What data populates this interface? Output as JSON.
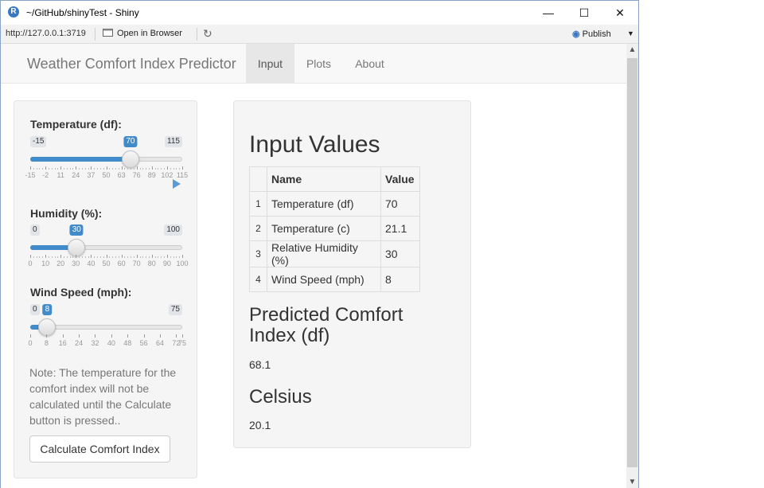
{
  "window": {
    "title": "~/GitHub/shinyTest - Shiny",
    "logo_letter": "R",
    "min_glyph": "—",
    "max_glyph": "☐",
    "close_glyph": "✕"
  },
  "toolbar": {
    "url": "http://127.0.0.1:3719",
    "open_in_browser": "Open in Browser",
    "refresh_glyph": "↻",
    "publish": "Publish",
    "publish_dropdown_glyph": "▼"
  },
  "navbar": {
    "brand": "Weather Comfort Index Predictor",
    "tabs": [
      {
        "label": "Input",
        "active": true
      },
      {
        "label": "Plots",
        "active": false
      },
      {
        "label": "About",
        "active": false
      }
    ]
  },
  "sidebar": {
    "sliders": [
      {
        "label": "Temperature (df):",
        "min": -15,
        "max": 115,
        "value": 70,
        "min_text": "-15",
        "max_text": "115",
        "value_text": "70",
        "tick_labels": [
          "-15",
          "-2",
          "11",
          "24",
          "37",
          "50",
          "63",
          "76",
          "89",
          "102",
          "115"
        ],
        "has_play_button": true
      },
      {
        "label": "Humidity (%):",
        "min": 0,
        "max": 100,
        "value": 30,
        "min_text": "0",
        "max_text": "100",
        "value_text": "30",
        "tick_labels": [
          "0",
          "10",
          "20",
          "30",
          "40",
          "50",
          "60",
          "70",
          "80",
          "90",
          "100"
        ],
        "has_play_button": false
      },
      {
        "label": "Wind Speed (mph):",
        "min": 0,
        "max": 75,
        "value": 8,
        "min_text": "0",
        "max_text": "75",
        "value_text": "8",
        "tick_labels": [
          "0",
          "8",
          "16",
          "24",
          "32",
          "40",
          "48",
          "56",
          "64",
          "72",
          "75"
        ],
        "tick_values": [
          0,
          8,
          16,
          24,
          32,
          40,
          48,
          56,
          64,
          72,
          75
        ],
        "has_play_button": false
      }
    ],
    "note": "Note: The temperature for the comfort index will not be calculated until the Calculate button is pressed..",
    "calculate_button": "Calculate Comfort Index"
  },
  "main": {
    "input_heading": "Input Values",
    "table": {
      "headers": [
        "",
        "Name",
        "Value"
      ],
      "rows": [
        {
          "n": "1",
          "name": "Temperature (df)",
          "value": "70"
        },
        {
          "n": "2",
          "name": "Temperature (c)",
          "value": "21.1"
        },
        {
          "n": "3",
          "name": "Relative Humidity (%)",
          "value": "30"
        },
        {
          "n": "4",
          "name": "Wind Speed (mph)",
          "value": "8"
        }
      ]
    },
    "predicted_heading": "Predicted Comfort Index (df)",
    "predicted_value": "68.1",
    "celsius_heading": "Celsius",
    "celsius_value": "20.1"
  },
  "colors": {
    "accent": "#428bca",
    "navbar_bg": "#f8f8f8",
    "well_bg": "#f5f5f5"
  }
}
